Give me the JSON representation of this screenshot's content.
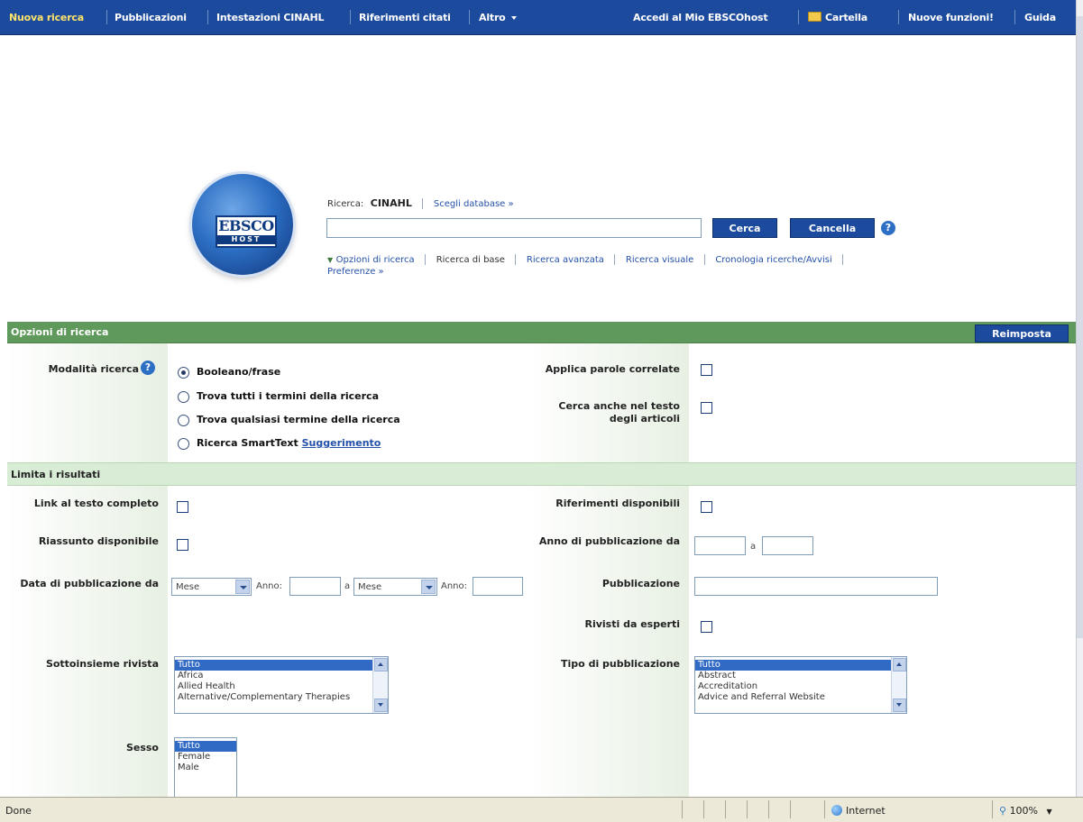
{
  "topnav": {
    "new_search": "Nuova ricerca",
    "publications": "Pubblicazioni",
    "cinahl_headings": "Intestazioni CINAHL",
    "cited_references": "Riferimenti citati",
    "more": "Altro",
    "sign_in": "Accedi al Mio EBSCOhost",
    "folder": "Cartella",
    "new_features": "Nuove funzioni!",
    "help": "Guida"
  },
  "logo": {
    "line1": "EBSCO",
    "line2": "HOST"
  },
  "search": {
    "label": "Ricerca:",
    "database": "CINAHL",
    "choose_db": "Scegli database »",
    "input_value": "",
    "search_button": "Cerca",
    "clear_button": "Cancella",
    "links": {
      "options": "Opzioni di ricerca",
      "basic": "Ricerca di base",
      "advanced": "Ricerca avanzata",
      "visual": "Ricerca visuale",
      "history": "Cronologia ricerche/Avvisi",
      "preferences": "Preferenze »"
    }
  },
  "options": {
    "title": "Opzioni di ricerca",
    "reset": "Reimposta",
    "mode_label": "Modalità ricerca",
    "modes": {
      "boolean": "Booleano/frase",
      "all_terms": "Trova tutti i termini della ricerca",
      "any_term": "Trova qualsiasi termine della ricerca",
      "smarttext": "Ricerca SmartText",
      "hint": "Suggerimento"
    },
    "selected_mode": "Booleano/frase",
    "related_words": "Applica parole correlate",
    "search_fulltext_1": "Cerca anche nel testo",
    "search_fulltext_2": "degli articoli"
  },
  "limits": {
    "title": "Limita i risultati",
    "fulltext_link": "Link al testo completo",
    "references_available": "Riferimenti disponibili",
    "abstract_available": "Riassunto disponibile",
    "pub_year_from": "Anno di pubblicazione da",
    "year_to": "a",
    "pub_date_from": "Data di pubblicazione da",
    "month_select_1": "Mese",
    "year_label_1": "Anno:",
    "to": "a",
    "month_select_2": "Mese",
    "year_label_2": "Anno:",
    "publication": "Pubblicazione",
    "peer_reviewed": "Rivisti da esperti",
    "journal_subset": "Sottoinsieme rivista",
    "journal_subset_options": [
      "Tutto",
      "Africa",
      "Allied Health",
      "Alternative/Complementary Therapies"
    ],
    "publication_type": "Tipo di pubblicazione",
    "publication_type_options": [
      "Tutto",
      "Abstract",
      "Accreditation",
      "Advice and Referral Website"
    ],
    "sex": "Sesso",
    "sex_options": [
      "Tutto",
      "Female",
      "Male"
    ]
  },
  "statusbar": {
    "status": "Done",
    "zone": "Internet",
    "zoom": "100%"
  },
  "colors": {
    "nav_blue": "#1c4a9c",
    "option_green": "#5f9a5c",
    "limit_green": "#d9ecd5"
  }
}
